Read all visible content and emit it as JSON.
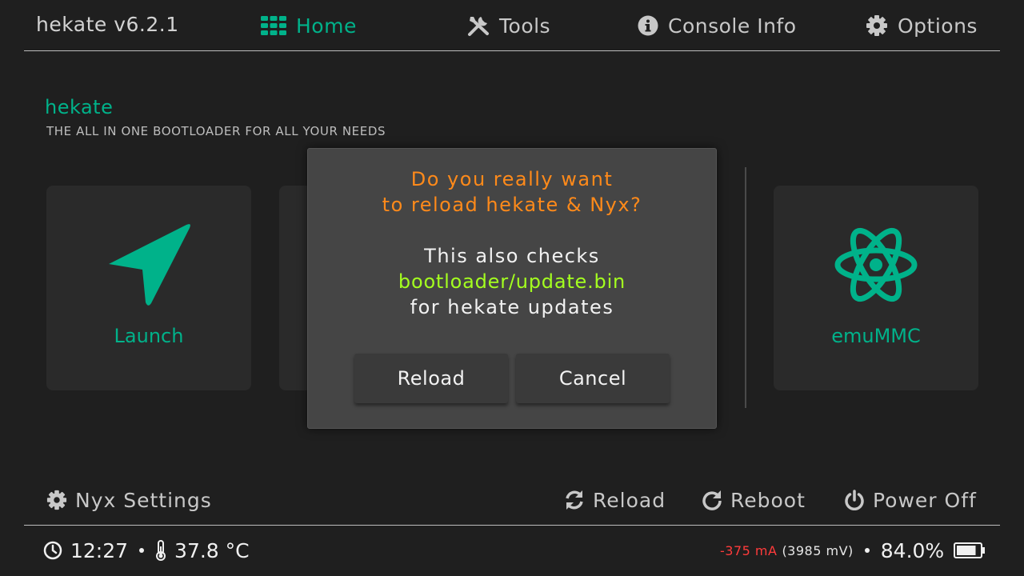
{
  "app_title": "hekate v6.2.1",
  "tabs": [
    {
      "label": "Home",
      "icon": "grid-icon",
      "active": true
    },
    {
      "label": "Tools",
      "icon": "tools-icon",
      "active": false
    },
    {
      "label": "Console Info",
      "icon": "info-icon",
      "active": false
    },
    {
      "label": "Options",
      "icon": "gear-icon",
      "active": false
    }
  ],
  "header": {
    "title": "hekate",
    "subtitle": "THE ALL IN ONE BOOTLOADER FOR ALL YOUR NEEDS"
  },
  "tiles": [
    {
      "label": "Launch",
      "icon": "navigation-arrow-icon"
    },
    {
      "label": "emuMMC",
      "icon": "atom-icon"
    }
  ],
  "dialog": {
    "question_line1": "Do you really want",
    "question_line2": "to reload hekate & Nyx?",
    "info_line1": "This also checks",
    "info_path": "bootloader/update.bin",
    "info_line3": "for hekate updates",
    "reload_label": "Reload",
    "cancel_label": "Cancel"
  },
  "actions": {
    "nyx_settings": "Nyx Settings",
    "reload": "Reload",
    "reboot": "Reboot",
    "power_off": "Power Off"
  },
  "status": {
    "time": "12:27",
    "temperature": "37.8 °C",
    "current": "-375 mA",
    "voltage": "(3985 mV)",
    "battery_percent": "84.0%",
    "battery_level": 0.84
  },
  "colors": {
    "accent": "#00b28a",
    "warning": "#ff8a1a",
    "path": "#a4ff1f",
    "negative_current": "#ff3b3b"
  }
}
